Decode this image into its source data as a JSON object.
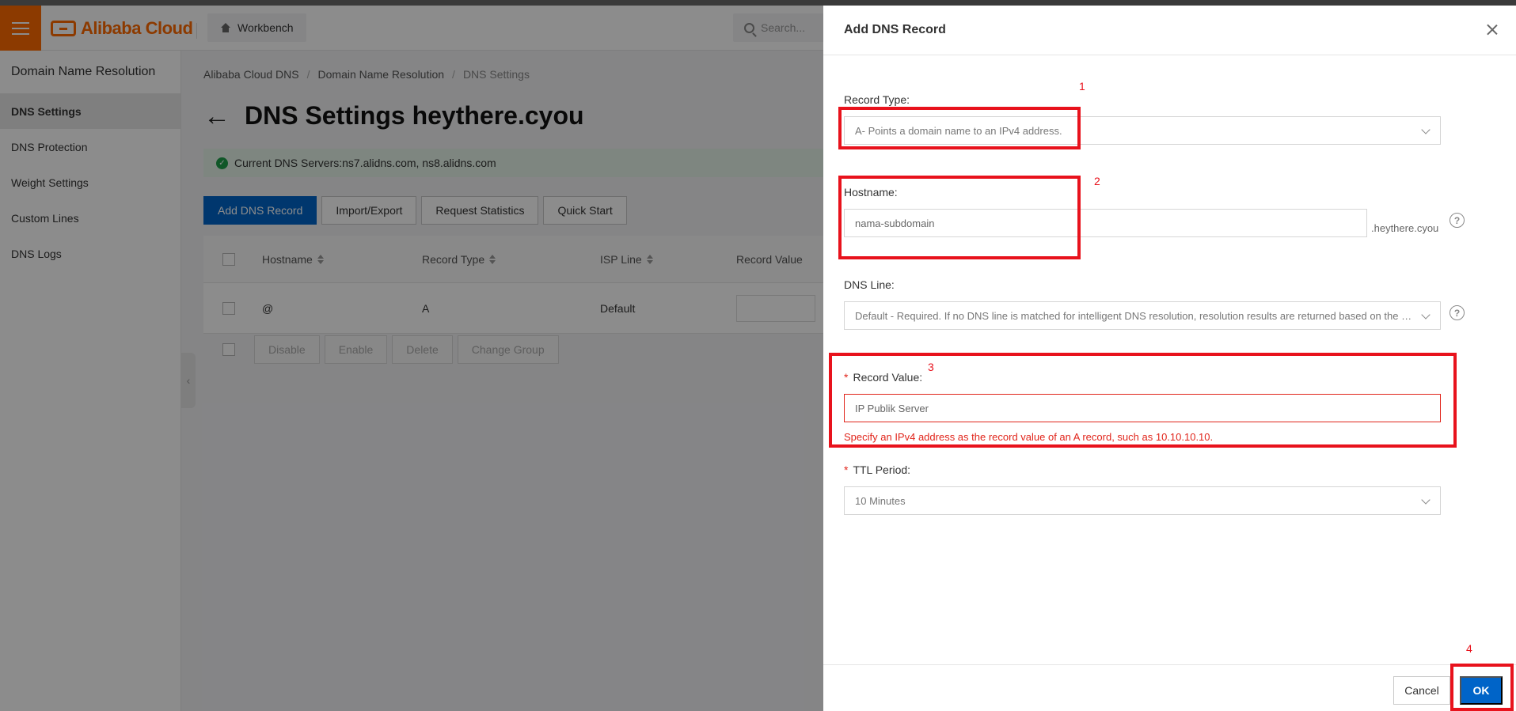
{
  "header": {
    "logo_text": "Alibaba Cloud",
    "workbench_label": "Workbench",
    "search_placeholder": "Search..."
  },
  "sidebar": {
    "title": "Domain Name Resolution",
    "items": [
      {
        "label": "DNS Settings",
        "active": true
      },
      {
        "label": "DNS Protection"
      },
      {
        "label": "Weight Settings"
      },
      {
        "label": "Custom Lines"
      },
      {
        "label": "DNS Logs"
      }
    ]
  },
  "main": {
    "breadcrumb": [
      "Alibaba Cloud DNS",
      "Domain Name Resolution",
      "DNS Settings"
    ],
    "page_title": "DNS Settings heythere.cyou",
    "dns_servers": "Current DNS Servers:ns7.alidns.com, ns8.alidns.com",
    "toolbar": {
      "add": "Add DNS Record",
      "import_export": "Import/Export",
      "request_stats": "Request Statistics",
      "quick_start": "Quick Start"
    },
    "table": {
      "columns": [
        "Hostname",
        "Record Type",
        "ISP Line",
        "Record Value"
      ],
      "rows": [
        {
          "hostname": "@",
          "record_type": "A",
          "isp_line": "Default",
          "record_value": ""
        }
      ]
    },
    "bulk_actions": [
      "Disable",
      "Enable",
      "Delete",
      "Change Group"
    ]
  },
  "drawer": {
    "title": "Add DNS Record",
    "record_type": {
      "label": "Record Type:",
      "value": "A- Points a domain name to an IPv4 address."
    },
    "hostname": {
      "label": "Hostname:",
      "value": "nama-subdomain",
      "suffix": ".heythere.cyou"
    },
    "dns_line": {
      "label": "DNS Line:",
      "value": "Default - Required. If no DNS line is matched for intelligent DNS resolution, resolution results are returned based on the default line."
    },
    "record_value": {
      "required_mark": "*",
      "label": "Record Value:",
      "value": "IP Publik Server",
      "error": "Specify an IPv4 address as the record value of an A record, such as 10.10.10.10."
    },
    "ttl": {
      "required_mark": "*",
      "label": "TTL Period:",
      "value": "10 Minutes"
    },
    "footer": {
      "cancel": "Cancel",
      "ok": "OK"
    }
  },
  "annotations": {
    "n1": "1",
    "n2": "2",
    "n3": "3",
    "n4": "4",
    "color": "#e8121c"
  },
  "colors": {
    "brand": "#ff6a00",
    "primary": "#0064c8",
    "error": "#e1251b",
    "success_bg": "#e5f5ea"
  }
}
